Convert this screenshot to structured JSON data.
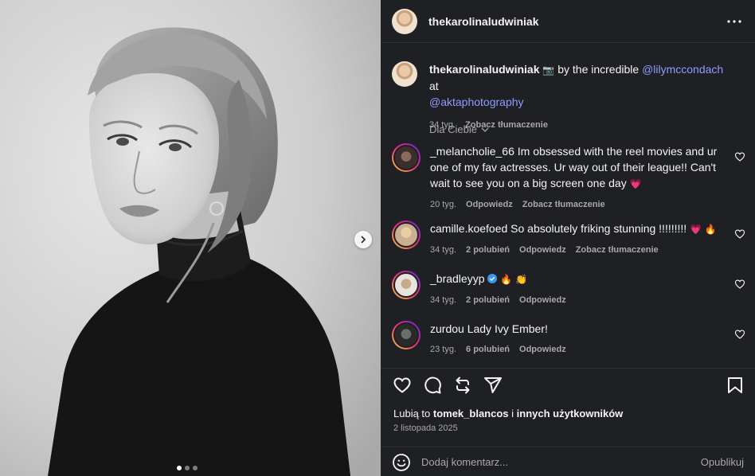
{
  "colors": {
    "panel_bg": "#1f2023",
    "mention": "#8f9bff",
    "heart_red": "#ff3b5c",
    "muted": "#a8a8a8"
  },
  "media": {
    "icon_next": "chevron-right-icon",
    "carousel_total": 3,
    "carousel_active": 1
  },
  "header": {
    "username": "thekarolinaludwiniak",
    "more_icon": "more-horizontal-icon"
  },
  "caption": {
    "username": "thekarolinaludwiniak",
    "emoji": "📷",
    "text_1": " by the incredible ",
    "mention_1": "@lilymccondach",
    "text_2": " at ",
    "mention_2": "@aktaphotography",
    "time": "34 tyg.",
    "translate": "Zobacz tłumaczenie"
  },
  "for_you": {
    "label": "Dla Ciebie"
  },
  "comments": [
    {
      "username": "_melancholie_66",
      "text": "Im obsessed with the reel movies and ur one of my fav actresses. Ur way out of their league!! Can't wait to see you on a big screen one day",
      "emoji": "💗",
      "time": "20 tyg.",
      "likes": "",
      "reply": "Odpowiedz",
      "translate": "Zobacz tłumaczenie"
    },
    {
      "username": "camille.koefoed",
      "text": "So absolutely friking stunning !!!!!!!!!",
      "emoji": "💗 🔥",
      "time": "34 tyg.",
      "likes": "2 polubień",
      "reply": "Odpowiedz",
      "translate": "Zobacz tłumaczenie"
    },
    {
      "username": "_bradleyyp",
      "text": "",
      "emoji": "🔥 👏",
      "time": "34 tyg.",
      "likes": "2 polubień",
      "reply": "Odpowiedz",
      "translate": ""
    },
    {
      "username": "zurdou",
      "text": "Lady Ivy Ember!",
      "emoji": "",
      "time": "23 tyg.",
      "likes": "6 polubień",
      "reply": "Odpowiedz",
      "translate": ""
    }
  ],
  "actions": {
    "like_icon": "heart-icon",
    "comment_icon": "comment-icon",
    "repost_icon": "repost-icon",
    "share_icon": "send-icon",
    "save_icon": "bookmark-icon"
  },
  "likes": {
    "prefix": "Lubią to ",
    "user": "tomek_blancos",
    "middle": " i ",
    "others": "innych użytkowników"
  },
  "date": "2 listopada 2025",
  "add_comment": {
    "placeholder": "Dodaj komentarz...",
    "publish": "Opublikuj"
  }
}
